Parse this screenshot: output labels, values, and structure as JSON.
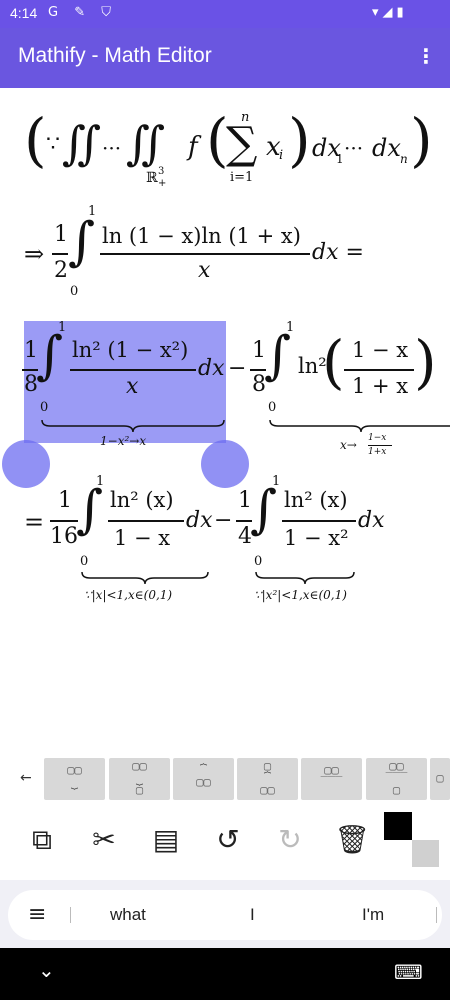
{
  "status": {
    "time": "4:14",
    "icons": "G ✎ ⛉",
    "right_icons": "▾◢▮"
  },
  "appbar": {
    "title": "Mathify - Math Editor",
    "menu": "⋮"
  },
  "math": {
    "l1_open": "(",
    "l1_because": "∵",
    "l1_int1": "∬",
    "l1_dots": "···",
    "l1_int2": "∬",
    "l1_sub": "ℝ",
    "l1_sub_sup": "3",
    "l1_sub_sub": "+",
    "l1_f": "f",
    "l1_open2": "(",
    "l1_sum": "∑",
    "l1_sum_top": "n",
    "l1_sum_bot": "i=1",
    "l1_x": "x",
    "l1_xi": "i",
    "l1_close2": ")",
    "l1_dx": "dx",
    "l1_dx_sub": "1",
    "l1_dots2": "···",
    "l1_dxn": "dx",
    "l1_dxn_sub": "n",
    "l1_close": ")",
    "l2_arrow": "⇒",
    "l2_num": "1",
    "l2_den": "2",
    "l2_int": "∫",
    "l2_top": "1",
    "l2_bot": "0",
    "l2_fnum": "ln (1 − x)ln (1 + x)",
    "l2_fden": "x",
    "l2_tail": "dx =",
    "l3_num": "1",
    "l3_den": "8",
    "l3_int": "∫",
    "l3_top": "1",
    "l3_bot": "0",
    "l3_fnum": "ln² (1 − x²)",
    "l3_fden": "x",
    "l3_dx": "dx",
    "l3_minus": "−",
    "l3_num2": "1",
    "l3_den2": "8",
    "l3_int2": "∫",
    "l3_top2": "1",
    "l3_bot2": "0",
    "l3_ln": "ln²",
    "l3_paren_open": "(",
    "l3_pnum": "1 − x",
    "l3_pden": "1 + x",
    "l3_paren_close": ")",
    "l3_brace1": "1−x²→x",
    "l3_brace2": "x→",
    "l3_brace2_num": "1−x",
    "l3_brace2_den": "1+x",
    "l4_eq": "=",
    "l4_num": "1",
    "l4_den": "16",
    "l4_int": "∫",
    "l4_top": "1",
    "l4_bot": "0",
    "l4_fnum": "ln² (x)",
    "l4_fden": "1 − x",
    "l4_dx": "dx",
    "l4_minus": "−",
    "l4_num2": "1",
    "l4_den2": "4",
    "l4_int2": "∫",
    "l4_top2": "1",
    "l4_bot2": "0",
    "l4_fnum2": "ln² (x)",
    "l4_fden2": "1 − x²",
    "l4_dx2": "dx",
    "l4_brace1": "∵|x|<1,x∈(0,1)",
    "l4_brace2": "∵|x²|<1,x∈(0,1)"
  },
  "templates": {
    "back": "←",
    "items": [
      "▢▢\n⏟",
      "▢▢\n⏟\n▢",
      "⏞\n▢▢",
      "▢\n⏞\n▢▢",
      "▢▢\n‾‾‾",
      "▢▢\n‾‾‾\n▢",
      "▢"
    ]
  },
  "actions": {
    "copy": "⧉",
    "cut": "✂",
    "paste": "▤",
    "undo": "↺",
    "redo": "↻",
    "delete": "🗑"
  },
  "suggestions": {
    "menu": "≡",
    "s1": "what",
    "s2": "I",
    "s3": "I'm"
  },
  "nav": {
    "down": "⌄",
    "keyboard": "⌨"
  }
}
